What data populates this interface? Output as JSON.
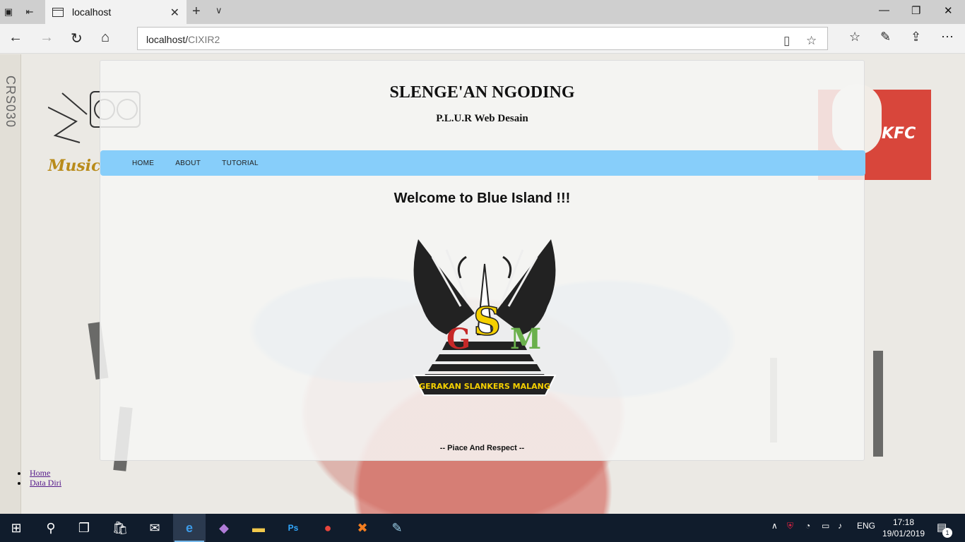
{
  "browser": {
    "tab_title": "localhost",
    "address_host": "localhost/",
    "address_path": "CIXIR2"
  },
  "page": {
    "side_text": "CRS030",
    "title": "SLENGE'AN NGODING",
    "subtitle": "P.L.U.R Web Desain",
    "menu": [
      "HOME",
      "ABOUT",
      "TUTORIAL"
    ],
    "welcome": "Welcome to Blue Island !!!",
    "logo_letters": {
      "g": "G",
      "s": "S",
      "m": "M"
    },
    "logo_banner": "GERAKAN SLANKERS MALANG",
    "motto": "-- Piace And Respect --",
    "links": [
      "Home",
      "Data Diri"
    ],
    "kfc_music_logo": "Music",
    "kfc_sign": "KFC"
  },
  "taskbar": {
    "lang": "ENG",
    "time": "17:18",
    "date": "19/01/2019",
    "notifications": "1"
  },
  "colors": {
    "menu_bar": "#87cefa",
    "taskbar": "#101c2c",
    "accent": "#76b9ed"
  }
}
